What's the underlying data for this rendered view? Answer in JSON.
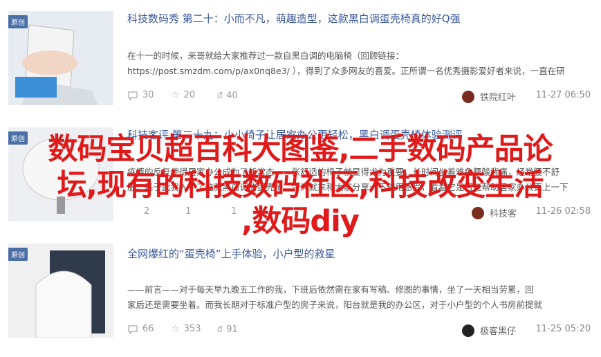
{
  "badge": "原创",
  "articles": [
    {
      "title": "科技数码秀 第二十：小而不凡，萌趣造型，这款黑白调蛋壳椅真的好Q强",
      "excerpt_lines": [
        "在十一的时候，来哥就给大家推荐过一款自黑白调的电脑椅（回顾链接：",
        "https://post.smzdm.com/p/ax0nq8e3/ ），得到了众多网友的喜爱。正所谓一名优秀摄影爱好者来说，一直在研"
      ],
      "comments": "30",
      "likes": "20",
      "favorites": "40",
      "author": "铁院红叶",
      "time": "11-27 06:50"
    },
    {
      "title": "科技客评 第二十九：小小椅子让居家办公更轻松，黑白调蛋壳椅体验测评",
      "excerpt_lines": [
        "疫情的反复使得居家办公成为了新常态，一张舒适的椅子就显得尤为重要，长时间坐着难免腰酸背痛，经常腰不舒",
        "服，基于此我入手了这款黑白调的蛋壳椅，今天就来和大家分享一下使用感受，看看它是否能帮助居家办公更上一下"
      ],
      "comments": "2",
      "likes": "1",
      "favorites": "1",
      "author": "科技客",
      "time": "11-26 02:58"
    },
    {
      "title": "全网爆红的“蛋壳椅”上手体验，小户型的救星",
      "excerpt_lines": [
        "——前言——对于每天早九晚五工作的我，下班后依然需在家有写稿、修图的事情，坐了一天相当劳累，回",
        "家后还是需要坐着。而我长期对于标准户型的房子来说，阳台就是我的办公区，对于小户型的个人书房前提就"
      ],
      "comments": "66",
      "likes": "353",
      "favorites": "91",
      "author": "极客黑仔",
      "time": "11-25 05:20"
    }
  ],
  "overlay_lines": [
    "数码宝贝超百科大图鉴,二手数码产品论",
    "坛,现有的科技数码社区,科技改变生活",
    ",数码diy"
  ]
}
